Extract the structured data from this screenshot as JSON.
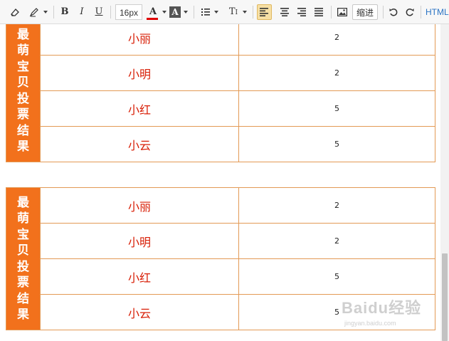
{
  "toolbar": {
    "font_size": "16px",
    "font_color_glyph": "A",
    "highlight_glyph": "A",
    "heading_glyph": "T",
    "indent_label": "缩进",
    "html_label": "HTML"
  },
  "tables": [
    {
      "label": "最萌宝贝投票结果",
      "rows": [
        {
          "name": "小丽",
          "votes": "2"
        },
        {
          "name": "小明",
          "votes": "2"
        },
        {
          "name": "小红",
          "votes": "5"
        },
        {
          "name": "小云",
          "votes": "5"
        }
      ]
    },
    {
      "label": "最萌宝贝投票结果",
      "rows": [
        {
          "name": "小丽",
          "votes": "2"
        },
        {
          "name": "小明",
          "votes": "2"
        },
        {
          "name": "小红",
          "votes": "5"
        },
        {
          "name": "小云",
          "votes": "5"
        }
      ]
    }
  ],
  "watermark": {
    "logo": "Baidu经验",
    "url": "jingyan.baidu.com"
  },
  "colors": {
    "label_bg": "#f2711c",
    "name_text": "#d81e06",
    "border": "#e39a55"
  }
}
